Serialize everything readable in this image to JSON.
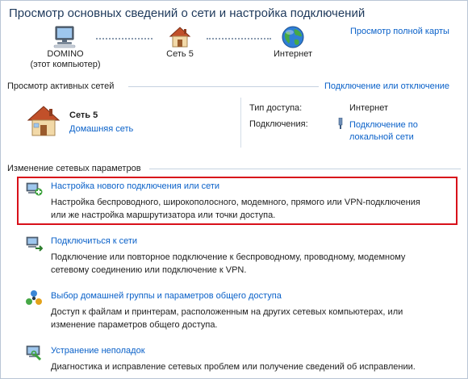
{
  "header": {
    "title": "Просмотр основных сведений о сети и настройка подключений",
    "full_map_link": "Просмотр полной карты"
  },
  "network_map": {
    "computer": {
      "name": "DOMINO",
      "subtitle": "(этот компьютер)",
      "icon": "computer-icon"
    },
    "network": {
      "name": "Сеть  5",
      "icon": "house-icon"
    },
    "internet": {
      "name": "Интернет",
      "icon": "globe-icon"
    }
  },
  "active_networks": {
    "header": "Просмотр активных сетей",
    "connect_link": "Подключение или отключение",
    "network_name": "Сеть  5",
    "network_type": "Домашняя сеть",
    "access_type_label": "Тип доступа:",
    "access_type_value": "Интернет",
    "connections_label": "Подключения:",
    "connections_line1": "Подключение по",
    "connections_line2": "локальной сети"
  },
  "change_settings": {
    "header": "Изменение сетевых параметров",
    "tasks": [
      {
        "title": "Настройка нового подключения или сети",
        "desc1": "Настройка беспроводного, широкополосного, модемного, прямого или VPN-подключения",
        "desc2": "или же настройка маршрутизатора или точки доступа.",
        "icon": "new-connection-icon"
      },
      {
        "title": "Подключиться к сети",
        "desc1": "Подключение или повторное подключение к беспроводному, проводному, модемному",
        "desc2": "сетевому соединению или подключение к VPN.",
        "icon": "connect-network-icon"
      },
      {
        "title": "Выбор домашней группы и параметров общего доступа",
        "desc1": "Доступ к файлам и принтерам, расположенным на других сетевых компьютерах, или",
        "desc2": "изменение параметров общего доступа.",
        "icon": "homegroup-icon"
      },
      {
        "title": "Устранение неполадок",
        "desc1": "Диагностика и исправление сетевых проблем или получение сведений об исправлении.",
        "desc2": "",
        "icon": "troubleshoot-icon"
      }
    ]
  },
  "colors": {
    "link": "#0a61c9",
    "title": "#1e395b",
    "highlight": "#d8101a"
  }
}
